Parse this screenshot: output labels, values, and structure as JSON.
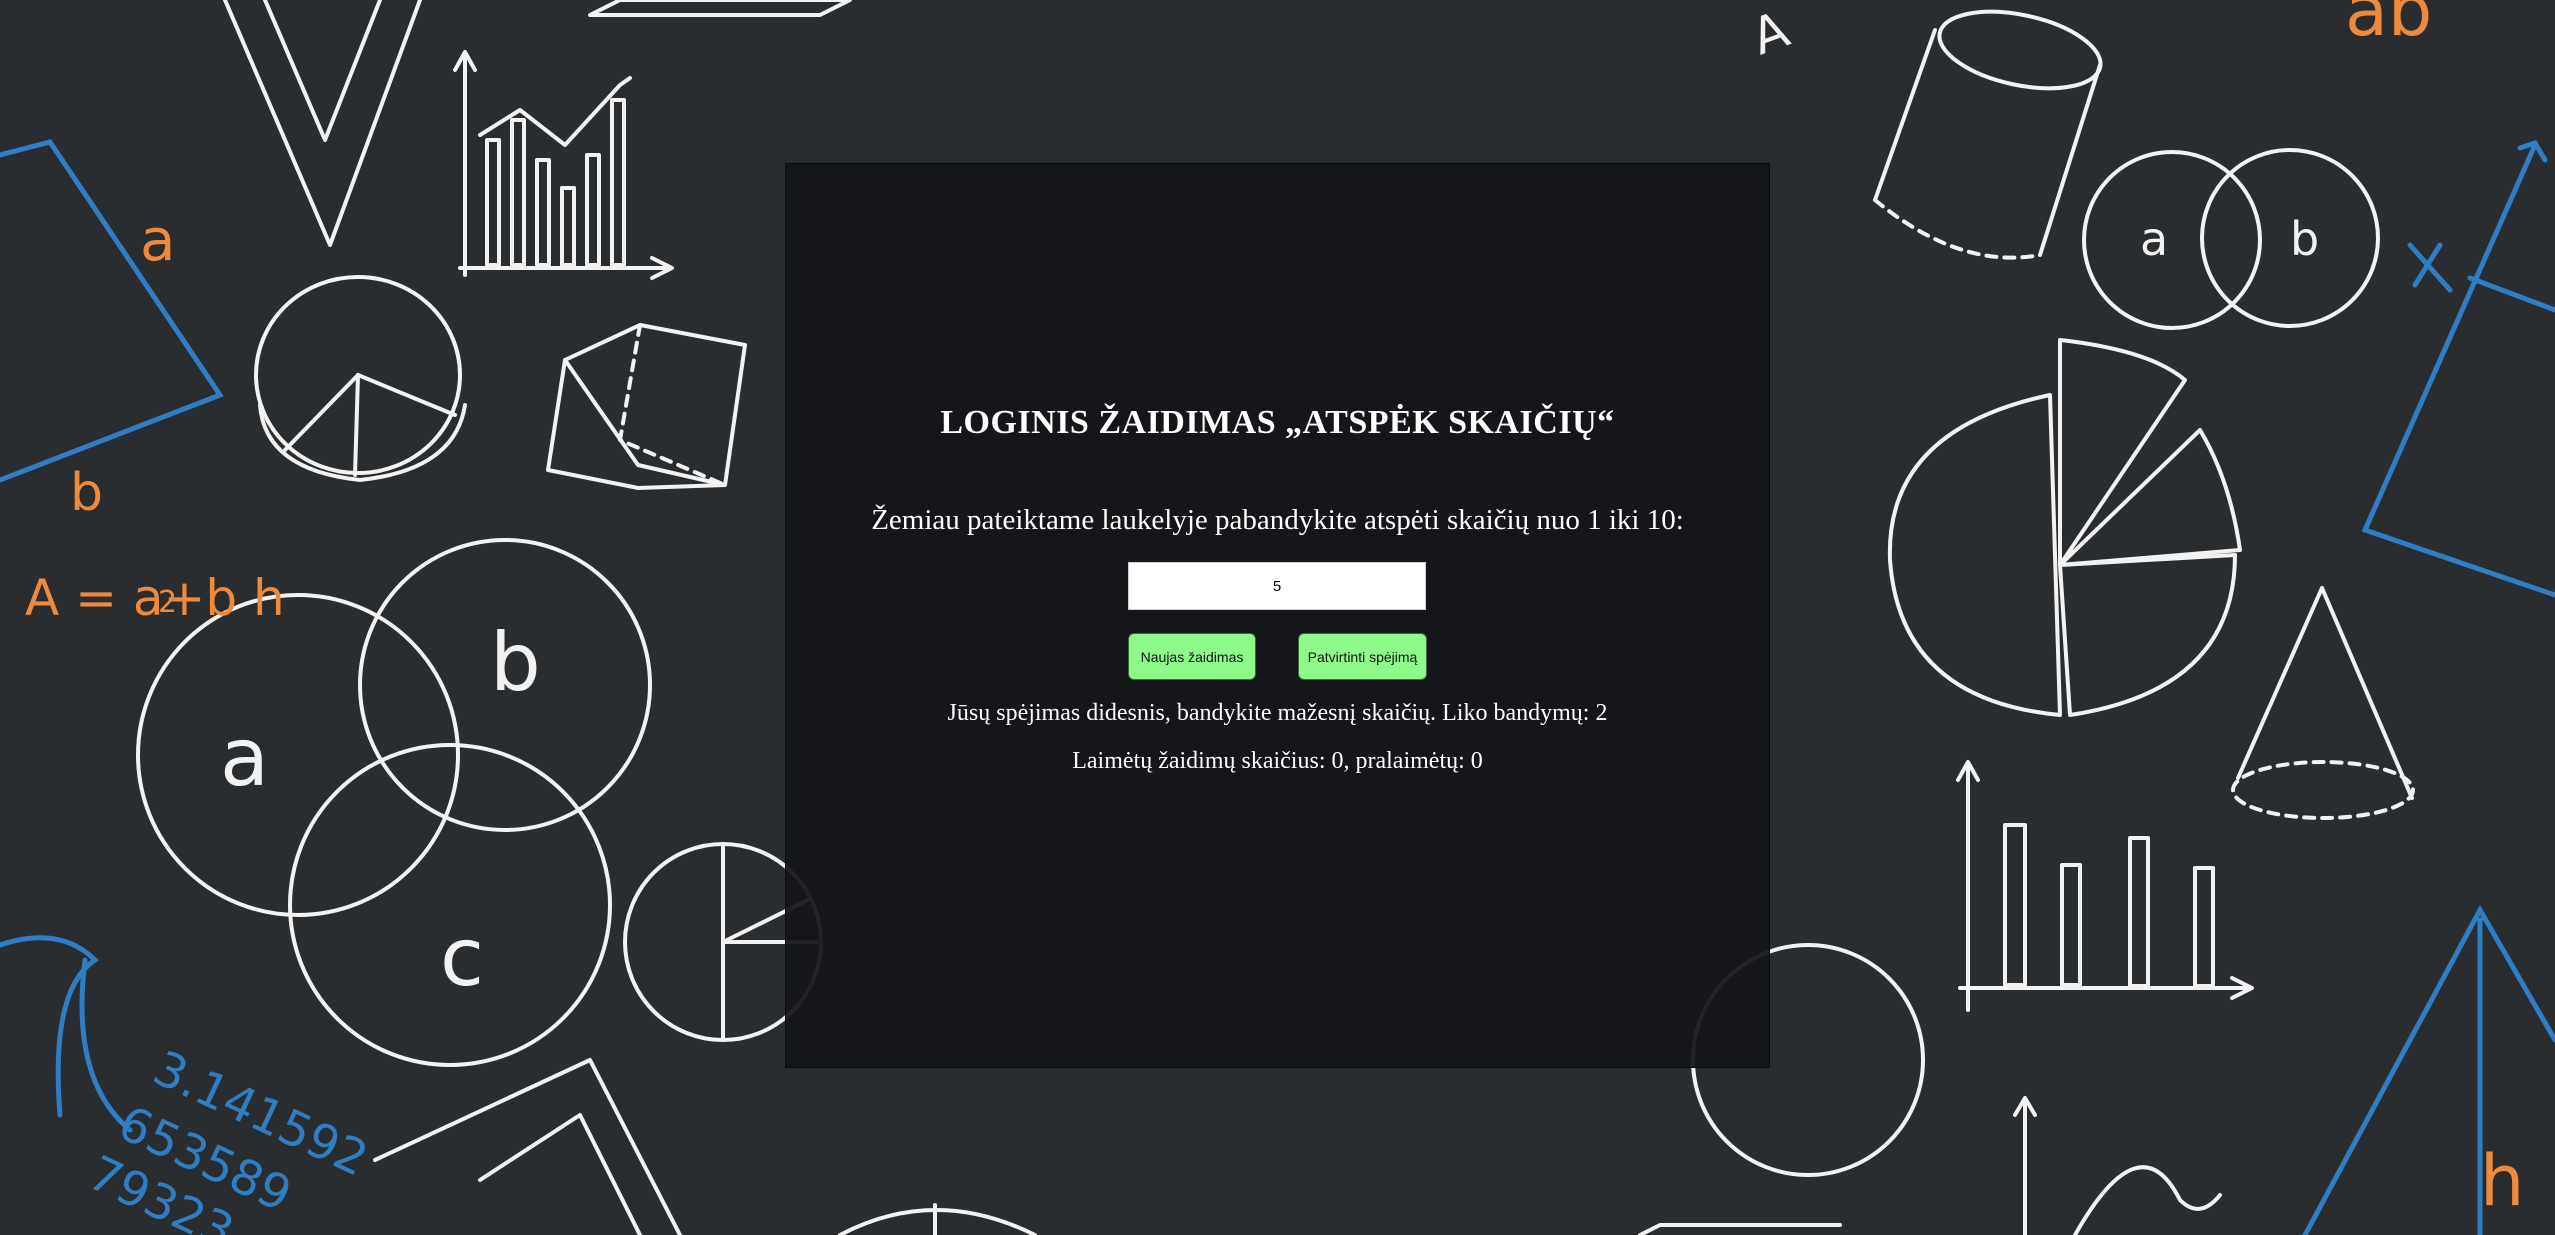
{
  "game": {
    "title": "LOGINIS ŽAIDIMAS „ATSPĖK SKAIČIŲ“",
    "instructions": "Žemiau pateiktame laukelyje pabandykite atspėti skaičių nuo 1 iki 10:",
    "guess_value": "5",
    "new_game_label": "Naujas žaidimas",
    "confirm_label": "Patvirtinti spėjimą",
    "feedback": "Jūsų spėjimas didesnis, bandykite mažesnį skaičių. Liko bandymų: 2",
    "stats": "Laimėtų žaidimų skaičius: 0, pralaimėtų: 0"
  },
  "background": {
    "labels": {
      "a1": "a",
      "b1": "b",
      "formula": "A = a+b h",
      "formula_den": "2",
      "venn_a": "a",
      "venn_b": "b",
      "venn_c": "c",
      "pi_digits": [
        "3.141592",
        "653589",
        "79323"
      ],
      "small_a": "a",
      "small_b": "b",
      "x": "x",
      "h": "h",
      "ab": "ab",
      "corner_a": "A"
    },
    "colors": {
      "chalk": "#f2f2f2",
      "blue": "#2f7ec4",
      "orange": "#ee8a3c",
      "board": "#2a2d30"
    }
  }
}
